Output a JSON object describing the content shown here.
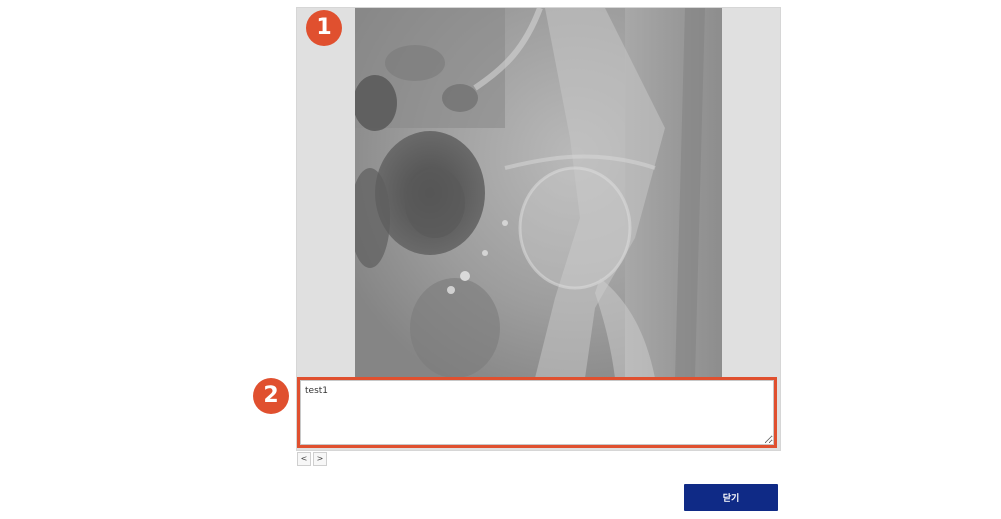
{
  "viewer": {
    "image_alt": "X-ray image"
  },
  "callouts": {
    "first": "1",
    "second": "2",
    "color": "#e0502f"
  },
  "memo": {
    "value": "test1"
  },
  "pager": {
    "prev_label": "<",
    "next_label": ">"
  },
  "footer": {
    "close_label": "닫기",
    "close_color": "#0f2a86"
  }
}
